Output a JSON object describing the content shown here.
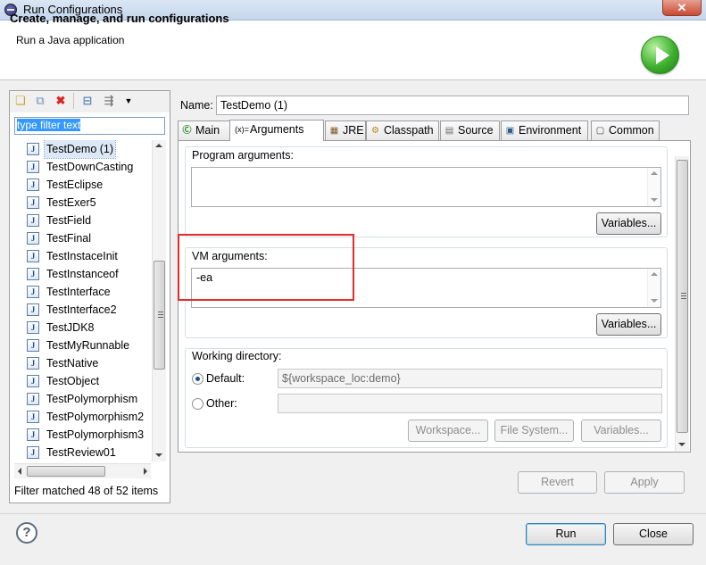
{
  "window": {
    "title": "Run Configurations",
    "close_glyph": "✕"
  },
  "header": {
    "title": "Create, manage, and run configurations",
    "subtitle": "Run a Java application"
  },
  "left": {
    "filter_placeholder": "type filter text",
    "items": [
      "TestDemo (1)",
      "TestDownCasting",
      "TestEclipse",
      "TestExer5",
      "TestField",
      "TestFinal",
      "TestInstaceInit",
      "TestInstanceof",
      "TestInterface",
      "TestInterface2",
      "TestJDK8",
      "TestMyRunnable",
      "TestNative",
      "TestObject",
      "TestPolymorphism",
      "TestPolymorphism2",
      "TestPolymorphism3",
      "TestReview01"
    ],
    "item_icon_glyph": "J",
    "status": "Filter matched 48 of 52 items"
  },
  "config": {
    "name_label": "Name:",
    "name_value": "TestDemo (1)",
    "tabs": [
      {
        "label": "Main",
        "icon": "Ⓒ"
      },
      {
        "label": "Arguments",
        "icon": "(x)="
      },
      {
        "label": "JRE",
        "icon": "▦"
      },
      {
        "label": "Classpath",
        "icon": "⚙"
      },
      {
        "label": "Source",
        "icon": "▤"
      },
      {
        "label": "Environment",
        "icon": "▣"
      },
      {
        "label": "Common",
        "icon": "▢"
      }
    ],
    "program_args_label": "Program arguments:",
    "program_args_value": "",
    "vm_args_label": "VM arguments:",
    "vm_args_value": "-ea",
    "variables_label": "Variables...",
    "working_dir_label": "Working directory:",
    "default_label": "Default:",
    "default_value": "${workspace_loc:demo}",
    "other_label": "Other:",
    "other_value": "",
    "workspace_btn": "Workspace...",
    "filesystem_btn": "File System...",
    "variables_btn": "Variables..."
  },
  "actions": {
    "revert": "Revert",
    "apply": "Apply",
    "run": "Run",
    "close": "Close",
    "help_glyph": "?"
  },
  "colors": {
    "accent_highlight": "#3399ff",
    "annotation_box": "#e32b2b",
    "run_icon_green": "#3fb02f"
  }
}
